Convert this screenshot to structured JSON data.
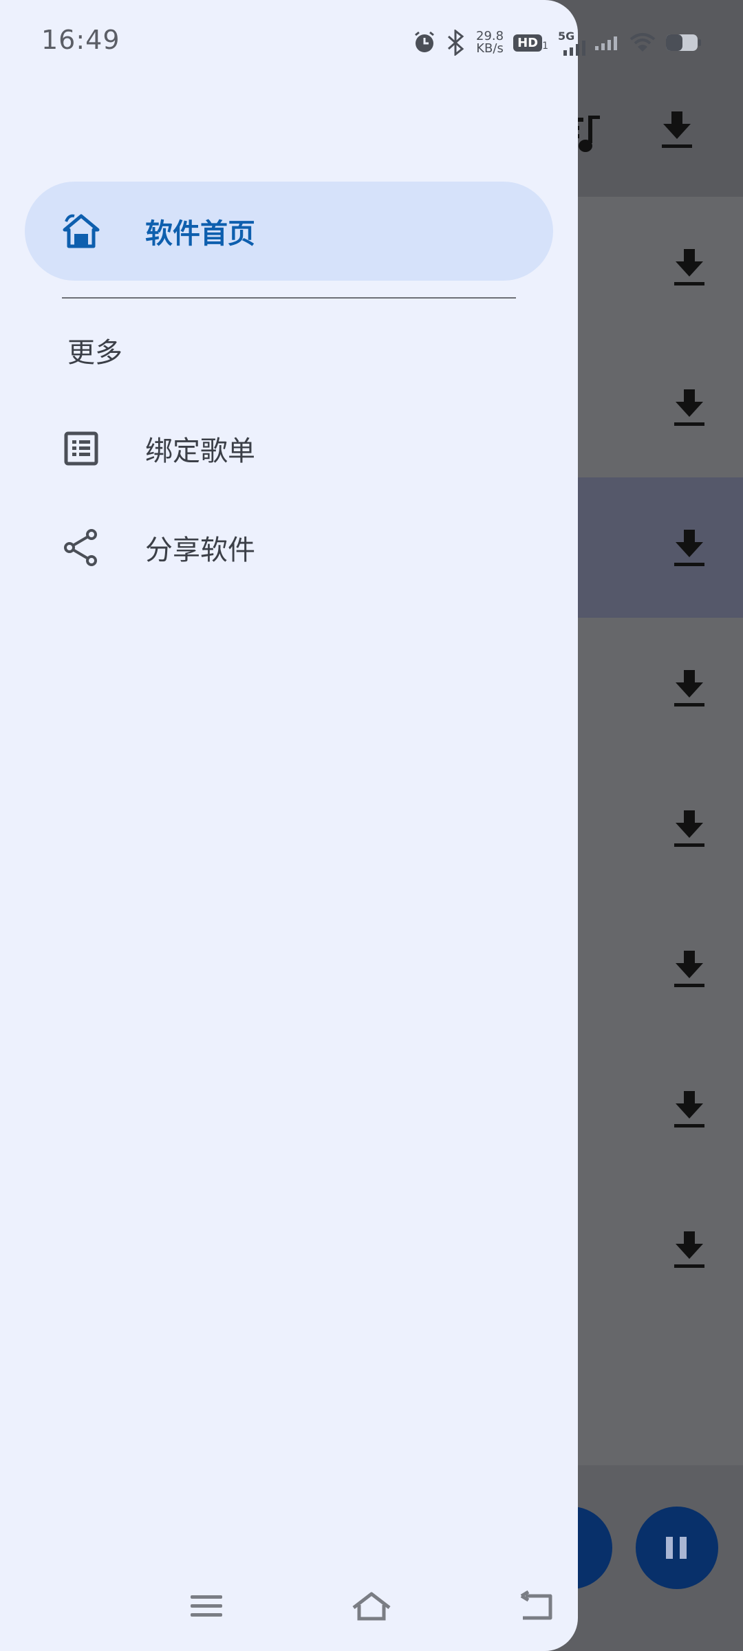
{
  "status_bar": {
    "time": "16:49",
    "net_speed_value": "29.8",
    "net_speed_unit": "KB/s",
    "hd_label": "HD",
    "hd_sub": "1",
    "network_type": "5G",
    "icons": [
      "alarm-icon",
      "bluetooth-icon",
      "hd-call-icon",
      "signal-5g-icon",
      "signal-icon",
      "wifi-icon",
      "battery-icon"
    ]
  },
  "drawer": {
    "items": [
      {
        "label": "软件首页",
        "icon": "home-icon",
        "active": true
      }
    ],
    "section_title": "更多",
    "more_items": [
      {
        "label": "绑定歌单",
        "icon": "list-icon"
      },
      {
        "label": "分享软件",
        "icon": "share-icon"
      }
    ]
  },
  "background_app": {
    "toolbar_icons": [
      "music-note-icon",
      "download-icon"
    ],
    "row_actions": [
      "download-icon"
    ],
    "fab_icons": [
      "pause-icon"
    ]
  },
  "system_nav": {
    "icons": [
      "menu-icon",
      "home-nav-icon",
      "back-icon"
    ]
  },
  "colors": {
    "drawer_bg": "#edf1fd",
    "active_pill": "#d6e2fa",
    "accent": "#0e5fae",
    "scrim": "#66676a"
  }
}
